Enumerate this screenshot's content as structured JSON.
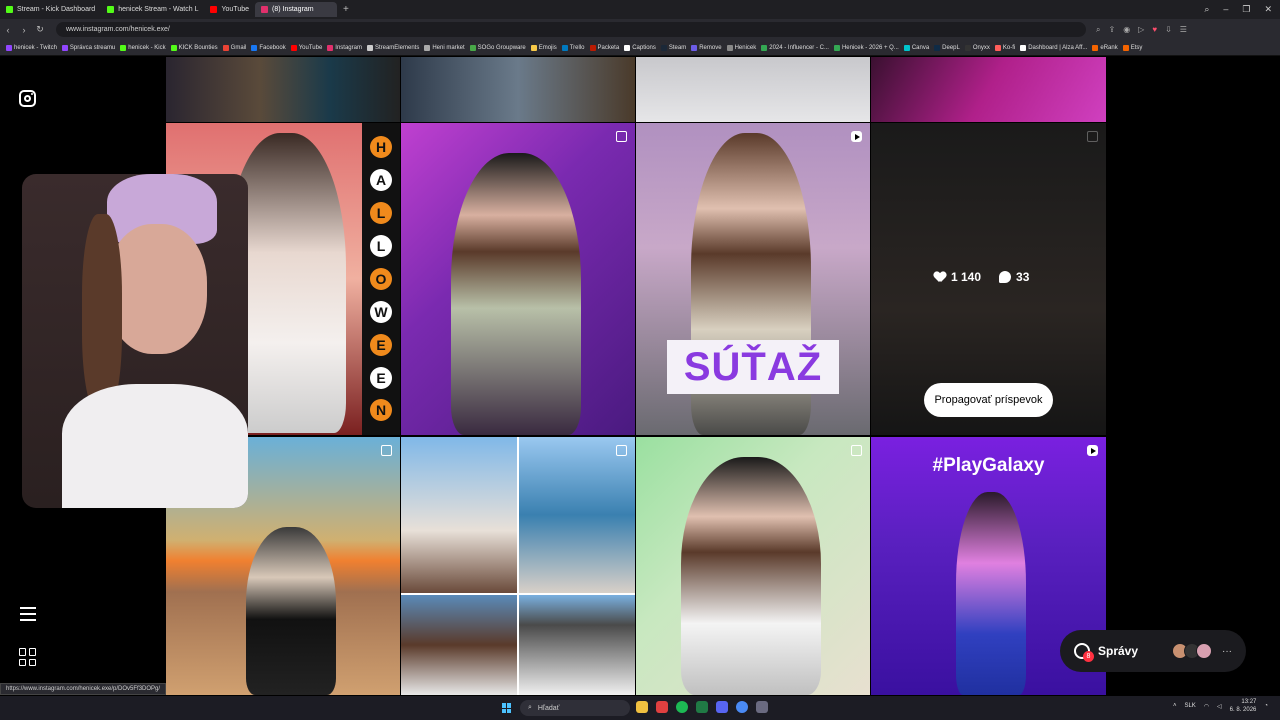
{
  "tabs": [
    {
      "title": "Stream - Kick Dashboard",
      "color": "#53fc18"
    },
    {
      "title": "henicek Stream - Watch L",
      "color": "#53fc18"
    },
    {
      "title": "YouTube",
      "color": "#ff0000"
    },
    {
      "title": "(8) Instagram",
      "color": "#e1306c",
      "active": true
    }
  ],
  "address": {
    "url": "www.instagram.com/henicek.exe/"
  },
  "bookmarks": [
    {
      "label": "henicek - Twitch",
      "color": "#9146ff"
    },
    {
      "label": "Správca streamu",
      "color": "#9146ff"
    },
    {
      "label": "henicek - Kick",
      "color": "#53fc18"
    },
    {
      "label": "KICK Bounties",
      "color": "#53fc18"
    },
    {
      "label": "Gmail",
      "color": "#ea4335"
    },
    {
      "label": "Facebook",
      "color": "#1877f2"
    },
    {
      "label": "YouTube",
      "color": "#ff0000"
    },
    {
      "label": "Instagram",
      "color": "#e1306c"
    },
    {
      "label": "StreamElements",
      "color": "#cccccc"
    },
    {
      "label": "Heni market",
      "color": "#aaaaaa"
    },
    {
      "label": "SOGo Groupware",
      "color": "#48a848"
    },
    {
      "label": "Emojis",
      "color": "#f7c948"
    },
    {
      "label": "Trello",
      "color": "#0079bf"
    },
    {
      "label": "Packeta",
      "color": "#ba1b02"
    },
    {
      "label": "Captions",
      "color": "#ffffff"
    },
    {
      "label": "Steam",
      "color": "#1b2838"
    },
    {
      "label": "Remove",
      "color": "#6c5ce7"
    },
    {
      "label": "Henicek",
      "color": "#888888"
    },
    {
      "label": "2024 - Influencer - C...",
      "color": "#34a853"
    },
    {
      "label": "Henicek - 2026 + Q...",
      "color": "#34a853"
    },
    {
      "label": "Canva",
      "color": "#00c4cc"
    },
    {
      "label": "DeepL",
      "color": "#0f2b46"
    },
    {
      "label": "Onyxx",
      "color": "#333333"
    },
    {
      "label": "Ko-fi",
      "color": "#ff5e5b"
    },
    {
      "label": "Dashboard | Alza Aff...",
      "color": "#ffffff"
    },
    {
      "label": "eRank",
      "color": "#f56400"
    },
    {
      "label": "Etsy",
      "color": "#f56400"
    }
  ],
  "post_stats": {
    "likes": "1 140",
    "comments": "33"
  },
  "promote_button": "Propagovať príspevok",
  "overlays": {
    "halloween_letters": [
      "H",
      "A",
      "L",
      "L",
      "O",
      "W",
      "E",
      "E",
      "N"
    ],
    "sutaz": "SÚŤAŽ",
    "play_galaxy": "#PlayGalaxy"
  },
  "messages": {
    "label": "Správy",
    "count": "8"
  },
  "status_url": "https://www.instagram.com/henicek.exe/p/DOv5Ff3DOPg/",
  "taskbar": {
    "search": "Hľadať",
    "lang": "SLK",
    "time": "13:27",
    "date": "6. 8. 2026"
  }
}
